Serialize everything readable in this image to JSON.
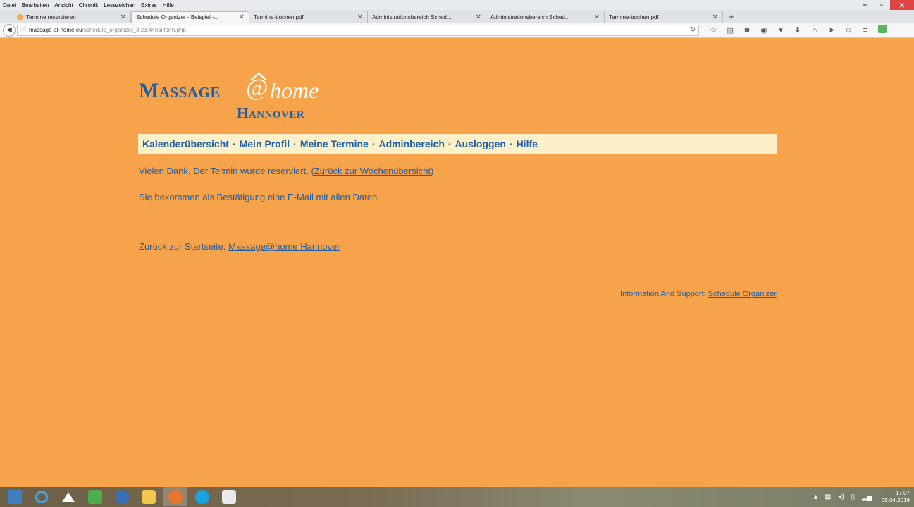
{
  "browser": {
    "menu": [
      "Datei",
      "Bearbeiten",
      "Ansicht",
      "Chronik",
      "Lesezeichen",
      "Extras",
      "Hilfe"
    ],
    "tabs": [
      {
        "label": "Termine reservieren",
        "active": false
      },
      {
        "label": "Schedule Organizer - Beispiel -...",
        "active": true
      },
      {
        "label": "Termine-buchen.pdf",
        "active": false
      },
      {
        "label": "Administrationsbereich Sched...",
        "active": false
      },
      {
        "label": "Administrationsbereich Sched...",
        "active": false
      },
      {
        "label": "Termine-buchen.pdf",
        "active": false
      }
    ],
    "new_tab": "+",
    "url_host": "massage-at-home.eu",
    "url_path": "/schedule_organizer_3.23.4/mailform.php"
  },
  "logo": {
    "massage": "Massage",
    "at": "@",
    "home": "home",
    "hannover": "Hannover"
  },
  "nav": {
    "items": [
      "Kalenderübersicht",
      "Mein Profil",
      "Meine Termine",
      "Adminbereich",
      "Ausloggen",
      "Hilfe"
    ],
    "separator": "·"
  },
  "content": {
    "msg1_text": "Vielen Dank. Der Termin wurde reserviert.",
    "msg1_link": "Zurück zur Wochenübersicht",
    "msg2": "Sie bekommen als Bestätigung eine E-Mail mit allen Daten.",
    "back_label": "Zurück zur Startseite:",
    "back_link": "Massage@home Hannover",
    "support_label": "Information And Support:",
    "support_link": "Schedule Organizer"
  },
  "taskbar": {
    "time": "17:07",
    "date": "05.04.2016"
  },
  "colors": {
    "page_bg": "#f6a34b",
    "brand_blue": "#1f5fa6",
    "nav_bg": "#fbf0c7"
  }
}
